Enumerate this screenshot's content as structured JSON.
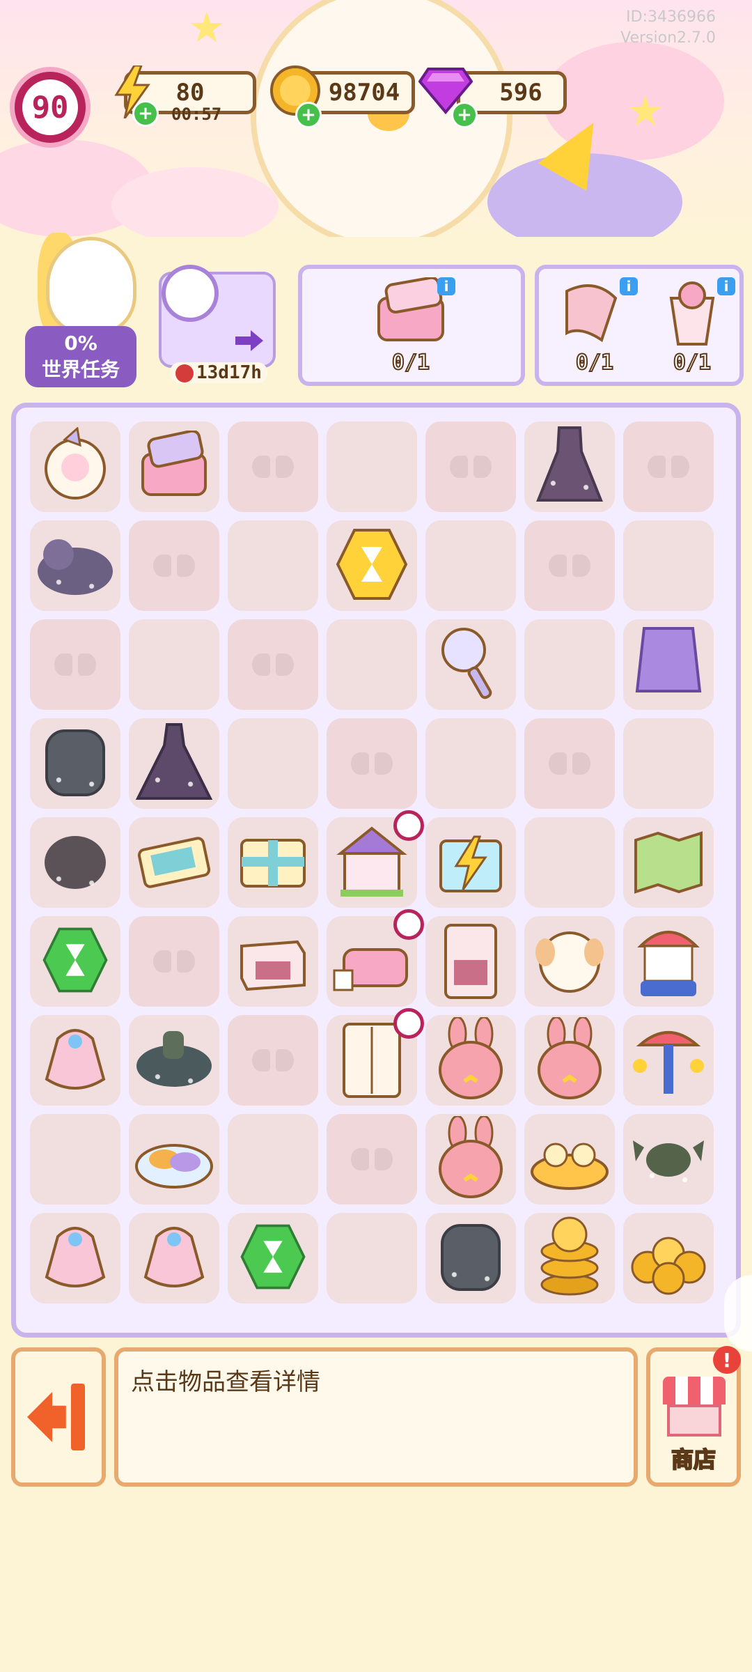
{
  "header": {
    "user_id": "ID:3436966",
    "version": "Version2.7.0"
  },
  "resources": {
    "level": "90",
    "energy": "80",
    "energy_timer": "00:57",
    "coins": "98704",
    "gems": "596"
  },
  "world_task": {
    "progress": "0%",
    "label": "世界任务"
  },
  "event": {
    "countdown": "13d17h"
  },
  "orders": [
    {
      "items": [
        {
          "name": "compact-mirror-icon",
          "count": "0/1"
        }
      ]
    },
    {
      "items": [
        {
          "name": "pink-scarf-icon",
          "count": "0/1"
        },
        {
          "name": "strawberry-drink-icon",
          "count": "0/1"
        }
      ]
    }
  ],
  "board": {
    "rows": [
      [
        "sheep-plush",
        "pink-compact",
        "locked",
        "empty",
        "locked",
        "cobweb-dress",
        "locked"
      ],
      [
        "cobweb-unicorn",
        "locked",
        "empty",
        "hourglass-gold",
        "empty",
        "locked",
        "empty"
      ],
      [
        "locked",
        "empty",
        "locked",
        "empty",
        "hand-mirror",
        "empty",
        "purple-outfit"
      ],
      [
        "cobweb-jar",
        "cobweb-gown",
        "empty",
        "locked",
        "empty",
        "locked",
        "empty"
      ],
      [
        "cobweb-ball",
        "ticket",
        "gift-box",
        "dollhouse",
        "energy-gift",
        "empty",
        "map"
      ],
      [
        "hourglass-green",
        "locked",
        "drawer",
        "pink-bed",
        "cabinet",
        "puppy-plush",
        "carousel"
      ],
      [
        "candy-bag",
        "cobweb-cannon",
        "locked",
        "wardrobe",
        "bunny-plush",
        "bunny-plush",
        "swing-ride"
      ],
      [
        "empty",
        "candy-plate",
        "empty",
        "locked",
        "bunny-plush",
        "teacup-ride",
        "cobweb-candy"
      ],
      [
        "candy-bag",
        "candy-bag",
        "hourglass-green",
        "empty",
        "cobweb-jar",
        "coin-stack",
        "coin-pile"
      ]
    ]
  },
  "detail_panel": {
    "hint": "点击物品查看详情"
  },
  "shop": {
    "label": "商店",
    "alert": "!"
  },
  "colors": {
    "background": "#fdf4d6",
    "board_border": "#c9b3ec",
    "panel_border": "#e8a96f",
    "level_ring": "#b8235b",
    "plus_green": "#46c04a"
  }
}
